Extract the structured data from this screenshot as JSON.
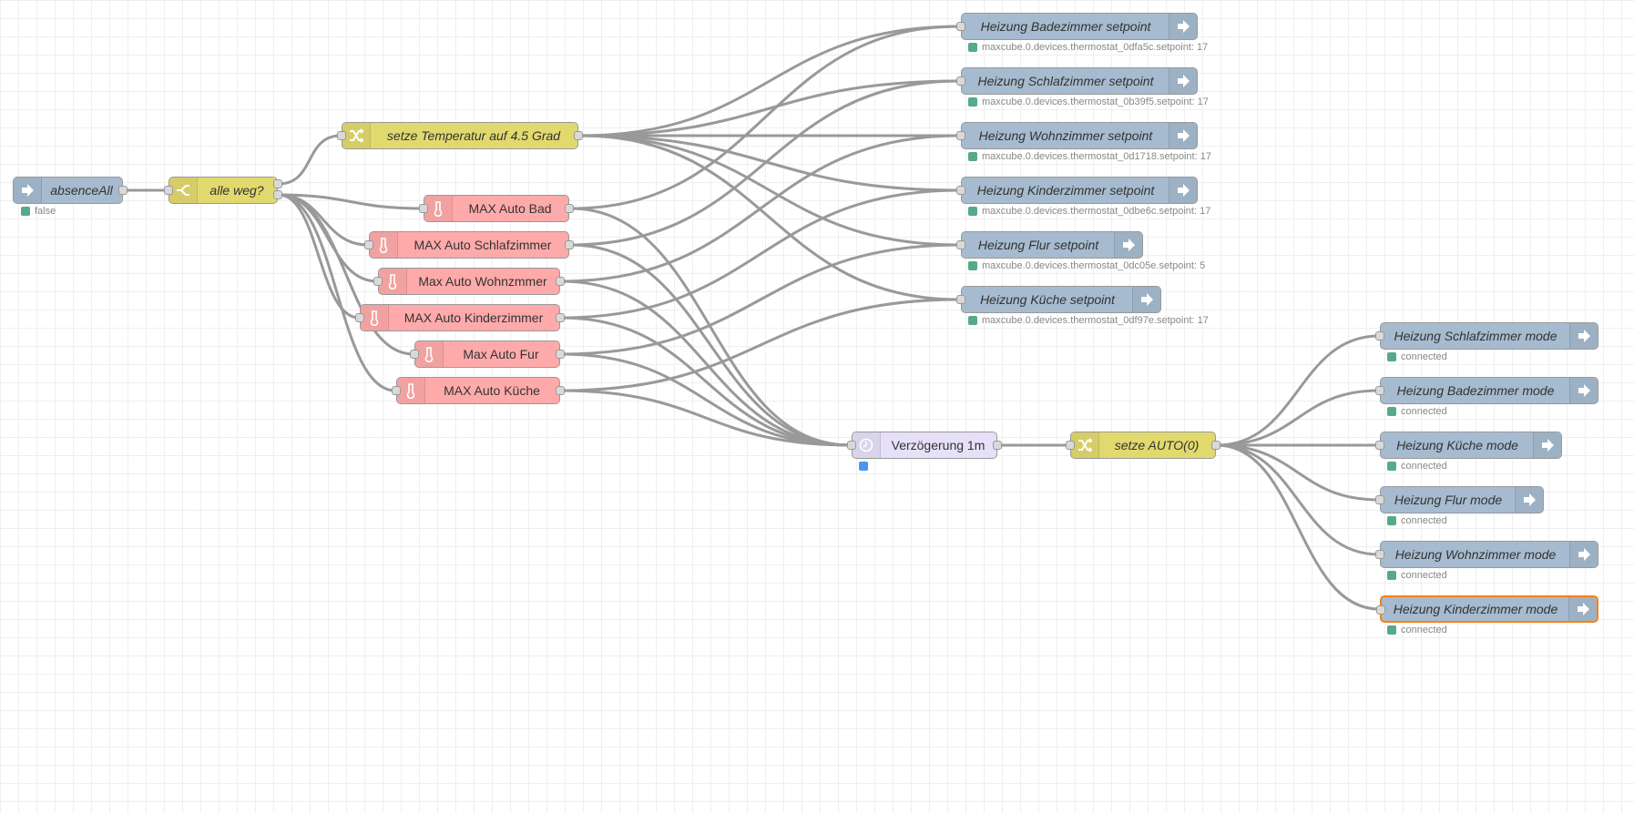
{
  "colors": {
    "link_in_out": "#a6bbcf",
    "function": "#e2d96e",
    "max": "#ffaaaa",
    "delay": "#e6e0f8",
    "status_green": "#5a8",
    "status_blue": "#49e",
    "wire": "#999999",
    "selected_border": "#ff7f0e"
  },
  "nodes": {
    "absenceAll": {
      "label": "absenceAll",
      "status": "false",
      "icon": "arrow-in-icon"
    },
    "alleweg": {
      "label": "alle weg?",
      "icon": "switch-icon"
    },
    "setze45": {
      "label": "setze Temperatur auf 4.5 Grad",
      "icon": "shuffle-icon"
    },
    "maxBad": {
      "label": "MAX Auto Bad",
      "icon": "thermometer-icon"
    },
    "maxSchlaf": {
      "label": "MAX Auto Schlafzimmer",
      "icon": "thermometer-icon"
    },
    "maxWohn": {
      "label": "Max Auto Wohnzmmer",
      "icon": "thermometer-icon"
    },
    "maxKinder": {
      "label": "MAX Auto Kinderzimmer",
      "icon": "thermometer-icon"
    },
    "maxFur": {
      "label": "Max Auto Fur",
      "icon": "thermometer-icon"
    },
    "maxKueche": {
      "label": "MAX Auto Küche",
      "icon": "thermometer-icon"
    },
    "delay": {
      "label": "Verzögerung 1m",
      "icon": "timer-icon"
    },
    "setzeAuto": {
      "label": "setze AUTO(0)",
      "icon": "shuffle-icon"
    },
    "spBad": {
      "label": "Heizung Badezimmer setpoint",
      "status": "maxcube.0.devices.thermostat_0dfa5c.setpoint: 17"
    },
    "spSchlaf": {
      "label": "Heizung Schlafzimmer setpoint",
      "status": "maxcube.0.devices.thermostat_0b39f5.setpoint: 17"
    },
    "spWohn": {
      "label": "Heizung Wohnzimmer setpoint",
      "status": "maxcube.0.devices.thermostat_0d1718.setpoint: 17"
    },
    "spKinder": {
      "label": "Heizung Kinderzimmer setpoint",
      "status": "maxcube.0.devices.thermostat_0dbe6c.setpoint: 17"
    },
    "spFlur": {
      "label": "Heizung Flur setpoint",
      "status": "maxcube.0.devices.thermostat_0dc05e.setpoint: 5"
    },
    "spKueche": {
      "label": "Heizung Küche setpoint",
      "status": "maxcube.0.devices.thermostat_0df97e.setpoint: 17"
    },
    "mSchlaf": {
      "label": "Heizung Schlafzimmer mode",
      "status": "connected"
    },
    "mBad": {
      "label": "Heizung Badezimmer mode",
      "status": "connected"
    },
    "mKueche": {
      "label": "Heizung Küche mode",
      "status": "connected"
    },
    "mFlur": {
      "label": "Heizung Flur mode",
      "status": "connected"
    },
    "mWohn": {
      "label": "Heizung Wohnzimmer mode",
      "status": "connected"
    },
    "mKinder": {
      "label": "Heizung Kinderzimmer mode",
      "status": "connected"
    }
  },
  "wires": [
    [
      "absenceAll",
      "alleweg"
    ],
    [
      "alleweg",
      "setze45"
    ],
    [
      "alleweg",
      "maxBad"
    ],
    [
      "alleweg",
      "maxSchlaf"
    ],
    [
      "alleweg",
      "maxWohn"
    ],
    [
      "alleweg",
      "maxKinder"
    ],
    [
      "alleweg",
      "maxFur"
    ],
    [
      "alleweg",
      "maxKueche"
    ],
    [
      "setze45",
      "spBad"
    ],
    [
      "setze45",
      "spSchlaf"
    ],
    [
      "setze45",
      "spWohn"
    ],
    [
      "setze45",
      "spKinder"
    ],
    [
      "setze45",
      "spFlur"
    ],
    [
      "setze45",
      "spKueche"
    ],
    [
      "maxBad",
      "spBad"
    ],
    [
      "maxSchlaf",
      "spSchlaf"
    ],
    [
      "maxWohn",
      "spWohn"
    ],
    [
      "maxKinder",
      "spKinder"
    ],
    [
      "maxFur",
      "spFlur"
    ],
    [
      "maxKueche",
      "spKueche"
    ],
    [
      "maxBad",
      "delay"
    ],
    [
      "maxSchlaf",
      "delay"
    ],
    [
      "maxWohn",
      "delay"
    ],
    [
      "maxKinder",
      "delay"
    ],
    [
      "maxFur",
      "delay"
    ],
    [
      "maxKueche",
      "delay"
    ],
    [
      "delay",
      "setzeAuto"
    ],
    [
      "setzeAuto",
      "mSchlaf"
    ],
    [
      "setzeAuto",
      "mBad"
    ],
    [
      "setzeAuto",
      "mKueche"
    ],
    [
      "setzeAuto",
      "mFlur"
    ],
    [
      "setzeAuto",
      "mWohn"
    ],
    [
      "setzeAuto",
      "mKinder"
    ]
  ]
}
